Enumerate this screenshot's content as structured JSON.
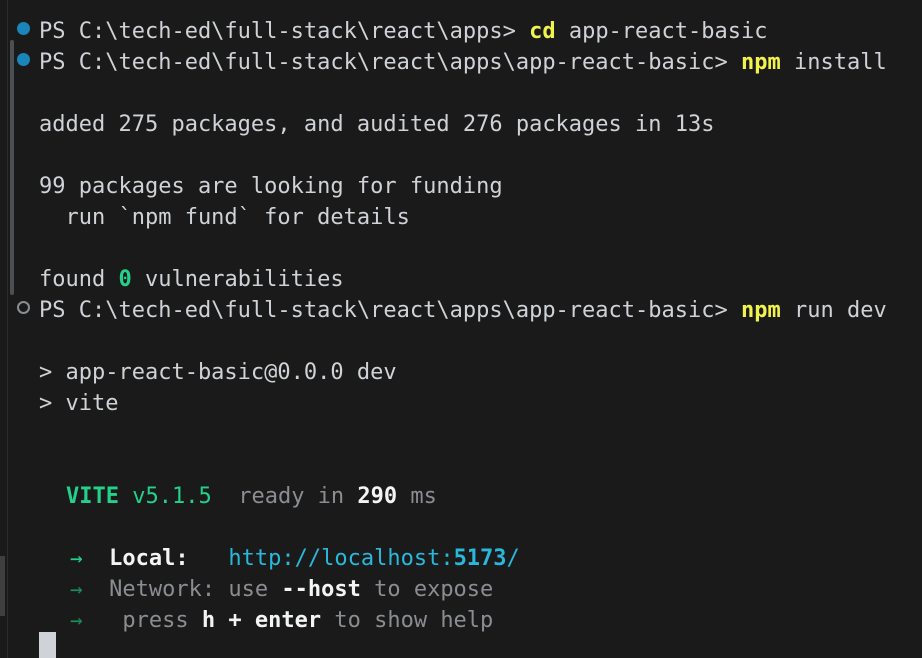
{
  "terminal": {
    "shell": "PowerShell",
    "background_color": "#1a1a1a",
    "foreground_color": "#cfd2d6",
    "accent_success_color": "#1a85b8",
    "accent_running_color": "#8a8d91",
    "prompt_prefix": "PS ",
    "cwd_initial": "C:\\tech-ed\\full-stack\\react\\apps",
    "cwd_after_cd": "C:\\tech-ed\\full-stack\\react\\apps\\app-react-basic",
    "prompt_suffix": "> "
  },
  "commands": [
    {
      "marker": "success-dot-icon",
      "prompt": "PS C:\\tech-ed\\full-stack\\react\\apps> ",
      "name": "cd",
      "args": " app-react-basic"
    },
    {
      "marker": "success-dot-icon",
      "prompt": "PS C:\\tech-ed\\full-stack\\react\\apps\\app-react-basic> ",
      "name": "npm",
      "args": " install"
    },
    {
      "marker": "running-circle-icon",
      "prompt": "PS C:\\tech-ed\\full-stack\\react\\apps\\app-react-basic> ",
      "name": "npm",
      "args": " run dev"
    }
  ],
  "npm_install_output": {
    "summary": "added 275 packages, and audited 276 packages in 13s",
    "added_count": 275,
    "audited_count": 276,
    "duration": "13s",
    "funding_line": "99 packages are looking for funding",
    "funding_count": 99,
    "funding_hint": "  run `npm fund` for details",
    "vulnerabilities_prefix": "found ",
    "vulnerabilities_count": "0",
    "vulnerabilities_suffix": " vulnerabilities"
  },
  "npm_run_output": {
    "script_header": "> app-react-basic@0.0.0 dev",
    "script_command": "> vite",
    "package_name": "app-react-basic",
    "package_version": "0.0.0",
    "script_name": "dev"
  },
  "vite_banner": {
    "name": "VITE",
    "version": "v5.1.5",
    "ready_label": "  ready in ",
    "ready_time": "290",
    "ready_unit": " ms",
    "rows": [
      {
        "arrow": "→",
        "arrow_style": "bright",
        "label": "Local:",
        "label_pad": "   ",
        "url_base": "http://localhost:",
        "url_port": "5173",
        "url_tail": "/"
      },
      {
        "arrow": "→",
        "arrow_style": "dim",
        "label": "Network:",
        "text_before": " use ",
        "emphasis": "--host",
        "text_after": " to expose"
      },
      {
        "arrow": "→",
        "arrow_style": "dim",
        "text_before": " press ",
        "emphasis_a": "h",
        "text_mid": " + ",
        "emphasis_b": "enter",
        "text_after": " to show help"
      }
    ]
  },
  "cursor": {
    "shape": "block",
    "color": "#cfd2d6"
  }
}
